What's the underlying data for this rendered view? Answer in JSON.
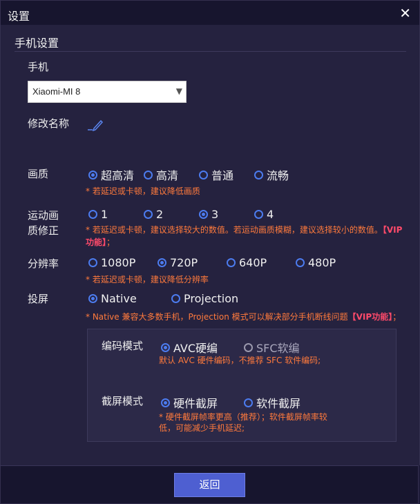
{
  "window": {
    "title": "设置",
    "close_icon": "✕"
  },
  "section": {
    "title": "手机设置"
  },
  "phone": {
    "label": "手机",
    "selected": "Xiaomi-MI 8",
    "arrow": "▼"
  },
  "rename": {
    "label": "修改名称"
  },
  "quality": {
    "label": "画质",
    "options": [
      "超高清",
      "高清",
      "普通",
      "流畅"
    ],
    "selected_index": 0,
    "note": "* 若延迟或卡顿，建议降低画质"
  },
  "motion": {
    "label_line1": "运动画",
    "label_line2": "质修正",
    "options": [
      "1",
      "2",
      "3",
      "4"
    ],
    "selected_index": 2,
    "note_line1": "* 若延迟或卡顿，建议选择较大的数值。若运动画质模糊，建议选择较小的数值。",
    "note_vip_tail": "【VIP",
    "note_vip_head": "功能】",
    "note_end": "；"
  },
  "resolution": {
    "label": "分辨率",
    "options": [
      "1080P",
      "720P",
      "640P",
      "480P"
    ],
    "selected_index": 1,
    "note": "* 若延迟或卡顿，建议降低分辨率"
  },
  "projection": {
    "label": "投屏",
    "options": [
      "Native",
      "Projection"
    ],
    "selected_index": 0,
    "note_main": "* Native 兼容大多数手机，Projection 模式可以解决部分手机断线问题",
    "note_vip": "【VIP功能】",
    "note_end": "；"
  },
  "encoding": {
    "label": "编码模式",
    "options": [
      "AVC硬编",
      "SFC软编"
    ],
    "selected_index": 0,
    "note": "默认 AVC 硬件编码，不推荐 SFC 软件编码;"
  },
  "capture": {
    "label": "截屏模式",
    "options": [
      "硬件截屏",
      "软件截屏"
    ],
    "selected_index": 0,
    "note_line1": "* 硬件截屏帧率更高（推荐）；软件截屏帧率较",
    "note_line2": "低，可能减少手机延迟;"
  },
  "footer": {
    "back_label": "返回"
  },
  "colors": {
    "accent": "#4c7cf0",
    "note": "#ff7a3c",
    "vip": "#ff4a6a",
    "button": "#4e5fd1"
  }
}
